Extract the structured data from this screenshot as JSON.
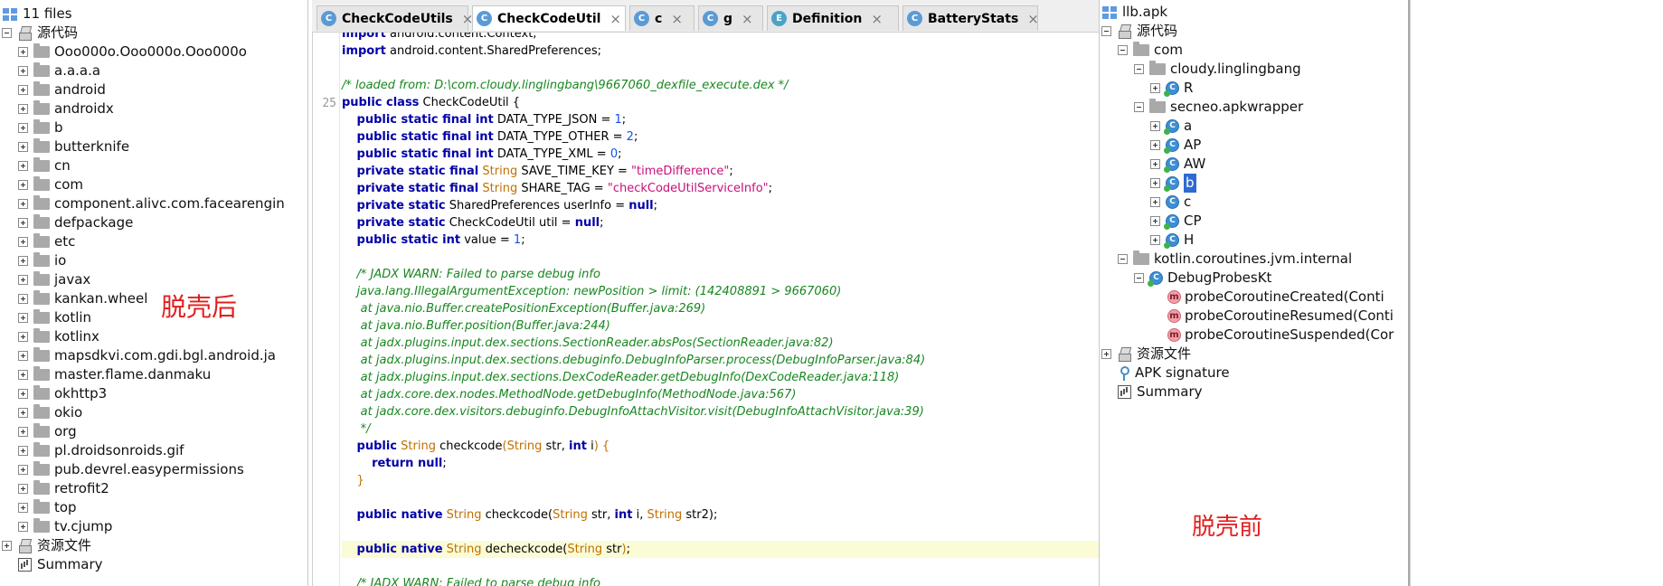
{
  "left_tree": {
    "root_label": "11 files",
    "source_label": "源代码",
    "packages": [
      "Ooo000o.Ooo000o.Ooo000o",
      "a.a.a.a",
      "android",
      "androidx",
      "b",
      "butterknife",
      "cn",
      "com",
      "component.alivc.com.facearengin",
      "defpackage",
      "etc",
      "io",
      "javax",
      "kankan.wheel",
      "kotlin",
      "kotlinx",
      "mapsdkvi.com.gdi.bgl.android.ja",
      "master.flame.danmaku",
      "okhttp3",
      "okio",
      "org",
      "pl.droidsonroids.gif",
      "pub.devrel.easypermissions",
      "retrofit2",
      "top",
      "tv.cjump"
    ],
    "resources_label": "资源文件",
    "summary_label": "Summary"
  },
  "left_annotation": "脱壳后",
  "right_annotation": "脱壳前",
  "tabs": [
    {
      "label": "CheckCodeUtils",
      "icon": "class-icon",
      "icon_text": "C",
      "active": false
    },
    {
      "label": "CheckCodeUtil",
      "icon": "class-icon",
      "icon_text": "C",
      "active": true
    },
    {
      "label": "c",
      "icon": "class-icon",
      "icon_text": "C",
      "active": false
    },
    {
      "label": "g",
      "icon": "class-icon",
      "icon_text": "C",
      "active": false
    },
    {
      "label": "Definition",
      "icon": "enum-icon",
      "icon_text": "E",
      "active": false
    },
    {
      "label": "BatteryStats",
      "icon": "class-icon",
      "icon_text": "C",
      "active": false
    }
  ],
  "tab_close_glyph": "×",
  "code": {
    "line_number": "25",
    "lines": [
      {
        "segs": [
          [
            "kw",
            "import"
          ],
          [
            "",
            ""
          ],
          [
            "fld",
            " android.content.Context;"
          ]
        ]
      },
      {
        "segs": [
          [
            "kw",
            "import"
          ],
          [
            "fld",
            " android.content.SharedPreferences;"
          ]
        ]
      },
      {
        "segs": [
          [
            "",
            ""
          ]
        ]
      },
      {
        "segs": [
          [
            "cm",
            "/* loaded from: D:\\com.cloudy.linglingbang\\9667060_dexfile_execute.dex */"
          ]
        ]
      },
      {
        "segs": [
          [
            "kw",
            "public class"
          ],
          [
            "fld",
            " CheckCodeUtil {"
          ]
        ]
      },
      {
        "segs": [
          [
            "fld",
            "    "
          ],
          [
            "kw",
            "public static final int"
          ],
          [
            "fld",
            " DATA_TYPE_JSON = "
          ],
          [
            "num",
            "1"
          ],
          [
            "fld",
            ";"
          ]
        ]
      },
      {
        "segs": [
          [
            "fld",
            "    "
          ],
          [
            "kw",
            "public static final int"
          ],
          [
            "fld",
            " DATA_TYPE_OTHER = "
          ],
          [
            "num",
            "2"
          ],
          [
            "fld",
            ";"
          ]
        ]
      },
      {
        "segs": [
          [
            "fld",
            "    "
          ],
          [
            "kw",
            "public static final int"
          ],
          [
            "fld",
            " DATA_TYPE_XML = "
          ],
          [
            "num",
            "0"
          ],
          [
            "fld",
            ";"
          ]
        ]
      },
      {
        "segs": [
          [
            "fld",
            "    "
          ],
          [
            "kw",
            "private static final"
          ],
          [
            "ty",
            " String"
          ],
          [
            "fld",
            " SAVE_TIME_KEY = "
          ],
          [
            "str",
            "\"timeDifference\""
          ],
          [
            "fld",
            ";"
          ]
        ]
      },
      {
        "segs": [
          [
            "fld",
            "    "
          ],
          [
            "kw",
            "private static final"
          ],
          [
            "ty",
            " String"
          ],
          [
            "fld",
            " SHARE_TAG = "
          ],
          [
            "str",
            "\"checkCodeUtilServiceInfo\""
          ],
          [
            "fld",
            ";"
          ]
        ]
      },
      {
        "segs": [
          [
            "fld",
            "    "
          ],
          [
            "kw",
            "private static"
          ],
          [
            "fld",
            " SharedPreferences userInfo = "
          ],
          [
            "kw",
            "null"
          ],
          [
            "fld",
            ";"
          ]
        ]
      },
      {
        "segs": [
          [
            "fld",
            "    "
          ],
          [
            "kw",
            "private static"
          ],
          [
            "fld",
            " CheckCodeUtil util = "
          ],
          [
            "kw",
            "null"
          ],
          [
            "fld",
            ";"
          ]
        ]
      },
      {
        "segs": [
          [
            "fld",
            "    "
          ],
          [
            "kw",
            "public static int"
          ],
          [
            "fld",
            " value = "
          ],
          [
            "num",
            "1"
          ],
          [
            "fld",
            ";"
          ]
        ]
      },
      {
        "segs": [
          [
            "",
            ""
          ]
        ]
      },
      {
        "segs": [
          [
            "fld",
            "    "
          ],
          [
            "cm",
            "/* JADX WARN: Failed to parse debug info"
          ]
        ]
      },
      {
        "segs": [
          [
            "fld",
            "    "
          ],
          [
            "cm",
            "java.lang.IllegalArgumentException: newPosition > limit: (142408891 > 9667060)"
          ]
        ]
      },
      {
        "segs": [
          [
            "fld",
            "    "
          ],
          [
            "cm",
            " at java.nio.Buffer.createPositionException(Buffer.java:269)"
          ]
        ]
      },
      {
        "segs": [
          [
            "fld",
            "    "
          ],
          [
            "cm",
            " at java.nio.Buffer.position(Buffer.java:244)"
          ]
        ]
      },
      {
        "segs": [
          [
            "fld",
            "    "
          ],
          [
            "cm",
            " at jadx.plugins.input.dex.sections.SectionReader.absPos(SectionReader.java:82)"
          ]
        ]
      },
      {
        "segs": [
          [
            "fld",
            "    "
          ],
          [
            "cm",
            " at jadx.plugins.input.dex.sections.debuginfo.DebugInfoParser.process(DebugInfoParser.java:84)"
          ]
        ]
      },
      {
        "segs": [
          [
            "fld",
            "    "
          ],
          [
            "cm",
            " at jadx.plugins.input.dex.sections.DexCodeReader.getDebugInfo(DexCodeReader.java:118)"
          ]
        ]
      },
      {
        "segs": [
          [
            "fld",
            "    "
          ],
          [
            "cm",
            " at jadx.core.dex.nodes.MethodNode.getDebugInfo(MethodNode.java:567)"
          ]
        ]
      },
      {
        "segs": [
          [
            "fld",
            "    "
          ],
          [
            "cm",
            " at jadx.core.dex.visitors.debuginfo.DebugInfoAttachVisitor.visit(DebugInfoAttachVisitor.java:39)"
          ]
        ]
      },
      {
        "segs": [
          [
            "fld",
            "    "
          ],
          [
            "cm",
            " */"
          ]
        ]
      },
      {
        "segs": [
          [
            "fld",
            "    "
          ],
          [
            "kw",
            "public"
          ],
          [
            "ty",
            " String"
          ],
          [
            "fld",
            " checkcode"
          ],
          [
            "ty",
            "("
          ],
          [
            "ty",
            "String"
          ],
          [
            "fld",
            " str, "
          ],
          [
            "kw",
            "int"
          ],
          [
            "fld",
            " i"
          ],
          [
            "ty",
            ") {"
          ]
        ]
      },
      {
        "segs": [
          [
            "fld",
            "        "
          ],
          [
            "kw",
            "return null"
          ],
          [
            "fld",
            ";"
          ]
        ]
      },
      {
        "segs": [
          [
            "fld",
            "    "
          ],
          [
            "ty",
            "}"
          ]
        ]
      },
      {
        "segs": [
          [
            "",
            ""
          ]
        ]
      },
      {
        "segs": [
          [
            "fld",
            "    "
          ],
          [
            "kw",
            "public native"
          ],
          [
            "ty",
            " String"
          ],
          [
            "fld",
            " checkcode("
          ],
          [
            "ty",
            "String"
          ],
          [
            "fld",
            " str, "
          ],
          [
            "kw",
            "int"
          ],
          [
            "fld",
            " i, "
          ],
          [
            "ty",
            "String"
          ],
          [
            "fld",
            " str2);"
          ]
        ]
      },
      {
        "segs": [
          [
            "",
            ""
          ]
        ]
      },
      {
        "segs": [
          [
            "fld",
            "    "
          ],
          [
            "kw",
            "public native"
          ],
          [
            "ty",
            " String"
          ],
          [
            "fld",
            " decheckcode("
          ],
          [
            "ty",
            "String"
          ],
          [
            "fld",
            " str"
          ],
          [
            "ty",
            ")"
          ],
          [
            "fld",
            ";"
          ]
        ],
        "highlight": true
      },
      {
        "segs": [
          [
            "",
            ""
          ]
        ]
      },
      {
        "segs": [
          [
            "fld",
            "    "
          ],
          [
            "cm",
            "/* JADX WARN: Failed to parse debug info"
          ]
        ]
      }
    ]
  },
  "right_tree": {
    "root_label": "llb.apk",
    "source_label": "源代码",
    "com_label": "com",
    "pkg1_label": "cloudy.linglingbang",
    "pkg1_class": "R",
    "pkg2_label": "secneo.apkwrapper",
    "pkg2_classes": [
      "a",
      "AP",
      "AW",
      "b",
      "c",
      "CP",
      "H"
    ],
    "selected_class": "b",
    "pkg3_label": "kotlin.coroutines.jvm.internal",
    "pkg3_class": "DebugProbesKt",
    "methods": [
      "probeCoroutineCreated(Conti",
      "probeCoroutineResumed(Conti",
      "probeCoroutineSuspended(Cor"
    ],
    "resources_label": "资源文件",
    "signature_label": "APK signature",
    "summary_label": "Summary"
  }
}
